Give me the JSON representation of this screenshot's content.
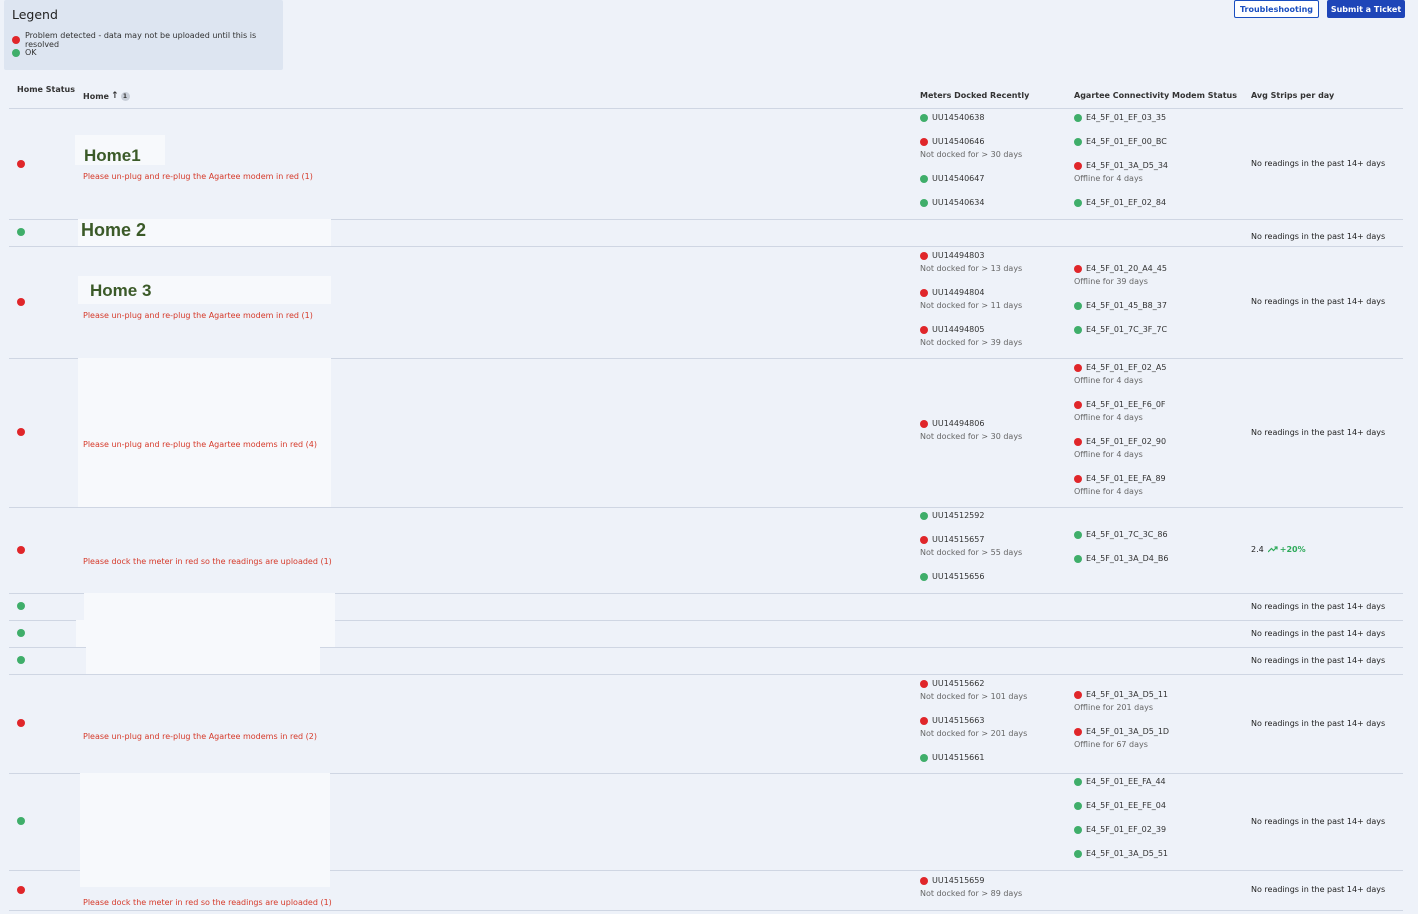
{
  "legend": {
    "title": "Legend",
    "problem_label": "Problem detected - data may not be uploaded until this is resolved",
    "ok_label": "OK",
    "problem_color": "#e0262a",
    "ok_color": "#3fae6a"
  },
  "toolbar": {
    "troubleshooting_label": "Troubleshooting",
    "submit_ticket_label": "Submit a Ticket"
  },
  "table": {
    "headers": {
      "home_status": "Home Status",
      "home": "Home",
      "home_sort_badge": "1",
      "meters": "Meters Docked Recently",
      "modem": "Agartee Connectivity Modem Status",
      "avg": "Avg Strips per day"
    },
    "rows": [
      {
        "status": "problem",
        "name": "Home1",
        "instruction": "Please un-plug and re-plug the Agartee modem in red (1)",
        "meters": [
          {
            "id": "UU14540638",
            "status": "ok",
            "note": ""
          },
          {
            "id": "UU14540646",
            "status": "problem",
            "note": "Not docked for > 30 days"
          },
          {
            "id": "UU14540647",
            "status": "ok",
            "note": ""
          },
          {
            "id": "UU14540634",
            "status": "ok",
            "note": ""
          }
        ],
        "modems": [
          {
            "id": "E4_5F_01_EF_03_35",
            "status": "ok",
            "note": ""
          },
          {
            "id": "E4_5F_01_EF_00_BC",
            "status": "ok",
            "note": ""
          },
          {
            "id": "E4_5F_01_3A_D5_34",
            "status": "problem",
            "note": "Offline for 4 days"
          },
          {
            "id": "E4_5F_01_EF_02_84",
            "status": "ok",
            "note": ""
          }
        ],
        "avg": "No readings in the past 14+ days"
      },
      {
        "status": "ok",
        "name": "Home 2",
        "instruction": "",
        "meters": [],
        "modems": [],
        "avg": "No readings in the past 14+ days"
      },
      {
        "status": "problem",
        "name": "Home 3",
        "instruction": "Please un-plug and re-plug the Agartee modem in red (1)",
        "meters": [
          {
            "id": "UU14494803",
            "status": "problem",
            "note": "Not docked for > 13 days"
          },
          {
            "id": "UU14494804",
            "status": "problem",
            "note": "Not docked for > 11 days"
          },
          {
            "id": "UU14494805",
            "status": "problem",
            "note": "Not docked for > 39 days"
          }
        ],
        "modems": [
          {
            "id": "E4_5F_01_20_A4_45",
            "status": "problem",
            "note": "Offline for 39 days"
          },
          {
            "id": "E4_5F_01_45_B8_37",
            "status": "ok",
            "note": ""
          },
          {
            "id": "E4_5F_01_7C_3F_7C",
            "status": "ok",
            "note": ""
          }
        ],
        "avg": "No readings in the past 14+ days"
      },
      {
        "status": "problem",
        "name": "",
        "instruction": "Please un-plug and re-plug the Agartee modems in red (4)",
        "meters": [
          {
            "id": "UU14494806",
            "status": "problem",
            "note": "Not docked for > 30 days"
          }
        ],
        "modems": [
          {
            "id": "E4_5F_01_EF_02_A5",
            "status": "problem",
            "note": "Offline for 4 days"
          },
          {
            "id": "E4_5F_01_EE_F6_0F",
            "status": "problem",
            "note": "Offline for 4 days"
          },
          {
            "id": "E4_5F_01_EF_02_90",
            "status": "problem",
            "note": "Offline for 4 days"
          },
          {
            "id": "E4_5F_01_EE_FA_89",
            "status": "problem",
            "note": "Offline for 4 days"
          }
        ],
        "avg": "No readings in the past 14+ days"
      },
      {
        "status": "problem",
        "name": "",
        "instruction": "Please dock the meter in red so the readings are uploaded (1)",
        "meters": [
          {
            "id": "UU14512592",
            "status": "ok",
            "note": ""
          },
          {
            "id": "UU14515657",
            "status": "problem",
            "note": "Not docked for > 55 days"
          },
          {
            "id": "UU14515656",
            "status": "ok",
            "note": ""
          }
        ],
        "modems": [
          {
            "id": "E4_5F_01_7C_3C_86",
            "status": "ok",
            "note": ""
          },
          {
            "id": "E4_5F_01_3A_D4_B6",
            "status": "ok",
            "note": ""
          }
        ],
        "avg": "2.4",
        "avg_trend": "+20%"
      },
      {
        "status": "ok",
        "name": "",
        "instruction": "",
        "meters": [],
        "modems": [],
        "avg": "No readings in the past 14+ days"
      },
      {
        "status": "ok",
        "name": "",
        "instruction": "",
        "meters": [],
        "modems": [],
        "avg": "No readings in the past 14+ days"
      },
      {
        "status": "ok",
        "name": "",
        "instruction": "",
        "meters": [],
        "modems": [],
        "avg": "No readings in the past 14+ days"
      },
      {
        "status": "problem",
        "name": "",
        "instruction": "Please un-plug and re-plug the Agartee modems in red (2)",
        "meters": [
          {
            "id": "UU14515662",
            "status": "problem",
            "note": "Not docked for > 101 days"
          },
          {
            "id": "UU14515663",
            "status": "problem",
            "note": "Not docked for > 201 days"
          },
          {
            "id": "UU14515661",
            "status": "ok",
            "note": ""
          }
        ],
        "modems": [
          {
            "id": "E4_5F_01_3A_D5_11",
            "status": "problem",
            "note": "Offline for 201 days"
          },
          {
            "id": "E4_5F_01_3A_D5_1D",
            "status": "problem",
            "note": "Offline for 67 days"
          }
        ],
        "avg": "No readings in the past 14+ days"
      },
      {
        "status": "ok",
        "name": "",
        "instruction": "",
        "meters": [],
        "modems": [
          {
            "id": "E4_5F_01_EE_FA_44",
            "status": "ok",
            "note": ""
          },
          {
            "id": "E4_5F_01_EE_FE_04",
            "status": "ok",
            "note": ""
          },
          {
            "id": "E4_5F_01_EF_02_39",
            "status": "ok",
            "note": ""
          },
          {
            "id": "E4_5F_01_3A_D5_51",
            "status": "ok",
            "note": ""
          }
        ],
        "avg": "No readings in the past 14+ days"
      },
      {
        "status": "problem",
        "name": "",
        "instruction": "Please dock the meter in red so the readings are uploaded (1)",
        "meters": [
          {
            "id": "UU14515659",
            "status": "problem",
            "note": "Not docked for > 89 days"
          }
        ],
        "modems": [],
        "avg": "No readings in the past 14+ days"
      }
    ]
  }
}
